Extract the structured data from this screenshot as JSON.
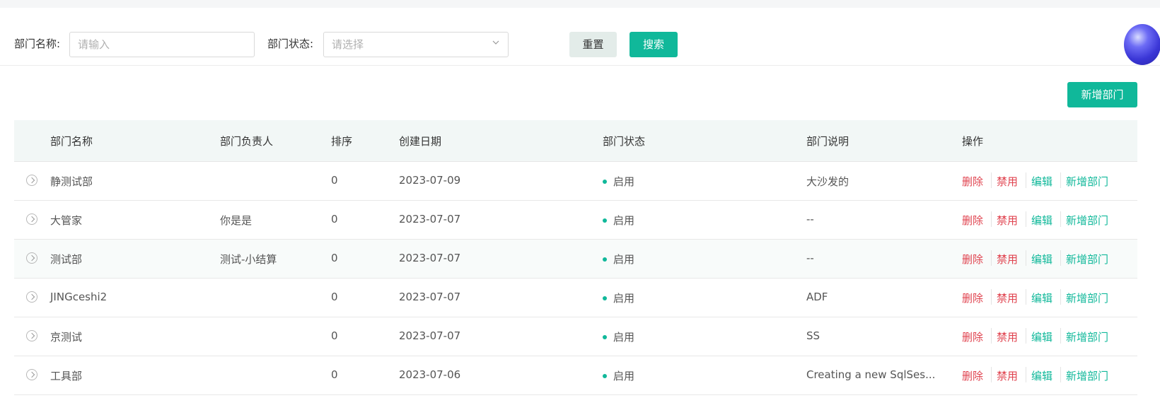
{
  "filters": {
    "dept_name_label": "部门名称:",
    "dept_name_placeholder": "请输入",
    "dept_status_label": "部门状态:",
    "dept_status_placeholder": "请选择",
    "reset_label": "重置",
    "search_label": "搜索"
  },
  "toolbar": {
    "add_dept_label": "新增部门"
  },
  "table": {
    "headers": [
      "部门名称",
      "部门负责人",
      "排序",
      "创建日期",
      "部门状态",
      "部门说明",
      "操作"
    ],
    "rows": [
      {
        "name": "静测试部",
        "leader": "",
        "order": "0",
        "date": "2023-07-09",
        "status": "启用",
        "desc": "大沙发的"
      },
      {
        "name": "大管家",
        "leader": "你是是",
        "order": "0",
        "date": "2023-07-07",
        "status": "启用",
        "desc": "--"
      },
      {
        "name": "测试部",
        "leader": "测试-小结算",
        "order": "0",
        "date": "2023-07-07",
        "status": "启用",
        "desc": "--"
      },
      {
        "name": "JINGceshi2",
        "leader": "",
        "order": "0",
        "date": "2023-07-07",
        "status": "启用",
        "desc": "ADF"
      },
      {
        "name": "京测试",
        "leader": "",
        "order": "0",
        "date": "2023-07-07",
        "status": "启用",
        "desc": "SS"
      },
      {
        "name": "工具部",
        "leader": "",
        "order": "0",
        "date": "2023-07-06",
        "status": "启用",
        "desc": "Creating a new SqlSes..."
      }
    ],
    "actions": {
      "delete": "删除",
      "disable": "禁用",
      "edit": "编辑",
      "add": "新增部门"
    }
  },
  "colors": {
    "accent": "#10b89a",
    "danger": "#e0434f"
  }
}
